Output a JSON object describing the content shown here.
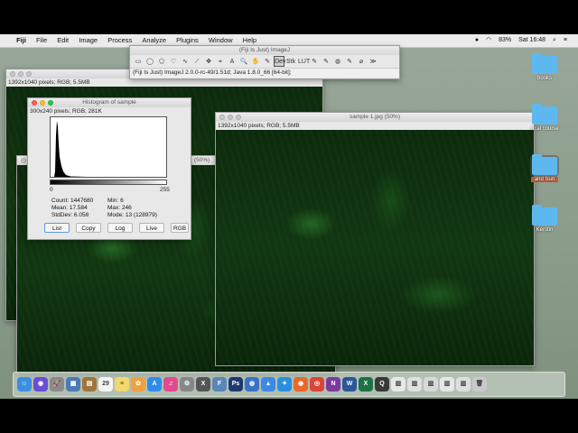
{
  "menubar": {
    "apple": "",
    "items": [
      "Fiji",
      "File",
      "Edit",
      "Image",
      "Process",
      "Analyze",
      "Plugins",
      "Window",
      "Help"
    ],
    "battery": "83%",
    "clock": "Sat 16:48"
  },
  "toolbar": {
    "title": "(Fiji Is Just) ImageJ",
    "status": "(Fiji Is Just) ImageJ 2.0.0-rc-49/1.51d; Java 1.8.0_66 [64-bit];",
    "tools": [
      "▭",
      "◯",
      "⬠",
      "♡",
      "∿",
      "⟋",
      "✥",
      "⌖",
      "A",
      "🔍",
      "✋",
      "✎",
      "Dev",
      "Stk",
      "LUT",
      "✎",
      "✎",
      "◍",
      "✎",
      "⌀",
      "≫"
    ]
  },
  "back_window": {
    "info": "1392x1040 pixels; RGB; 5.5MB"
  },
  "middle_window": {
    "title": "(50%)"
  },
  "histogram": {
    "title": "Histogram of sample",
    "info": "300x240 pixels; RGB; 281K",
    "axis_min": "0",
    "axis_max": "255",
    "count": "Count: 1447680",
    "mean": "Mean: 17.584",
    "stddev": "StdDev: 6.058",
    "min": "Min: 6",
    "max": "Max: 246",
    "mode": "Mode: 13 (128979)",
    "buttons": [
      "List",
      "Copy",
      "Log",
      "Live",
      "RGB"
    ]
  },
  "sample_window": {
    "title": "sample 1.jpg (50%)",
    "info": "1392x1040 pixels; RGB; 5.5MB"
  },
  "desktop_folders": [
    "books",
    "ocal course",
    "and Sun",
    "Kerstin"
  ],
  "dock_icons": [
    {
      "name": "finder-icon",
      "color": "#3b8fe0",
      "glyph": "☺"
    },
    {
      "name": "siri-icon",
      "color": "#6a4fd1",
      "glyph": "◉"
    },
    {
      "name": "launchpad-icon",
      "color": "#8a8a8a",
      "glyph": "🚀"
    },
    {
      "name": "preview-icon",
      "color": "#4a7ab8",
      "glyph": "▦"
    },
    {
      "name": "contacts-icon",
      "color": "#a0743c",
      "glyph": "▤"
    },
    {
      "name": "calendar-icon",
      "color": "#f4f4f4",
      "glyph": "29"
    },
    {
      "name": "notes-icon",
      "color": "#f4d76a",
      "glyph": "≡"
    },
    {
      "name": "photos-icon",
      "color": "#f0a040",
      "glyph": "✿"
    },
    {
      "name": "appstore-icon",
      "color": "#2f8de8",
      "glyph": "A"
    },
    {
      "name": "itunes-icon",
      "color": "#e24a8f",
      "glyph": "♫"
    },
    {
      "name": "gear-icon",
      "color": "#888888",
      "glyph": "⚙"
    },
    {
      "name": "xquartz-icon",
      "color": "#555555",
      "glyph": "X"
    },
    {
      "name": "fiji-icon",
      "color": "#5a86b8",
      "glyph": "F"
    },
    {
      "name": "photoshop-icon",
      "color": "#1d3a6e",
      "glyph": "Ps"
    },
    {
      "name": "globe-icon",
      "color": "#3a72c8",
      "glyph": "◍"
    },
    {
      "name": "keynote-icon",
      "color": "#3c88e8",
      "glyph": "▲"
    },
    {
      "name": "safari-icon",
      "color": "#2a8fe0",
      "glyph": "✦"
    },
    {
      "name": "firefox-icon",
      "color": "#e8692a",
      "glyph": "◉"
    },
    {
      "name": "chrome-icon",
      "color": "#d9453a",
      "glyph": "◎"
    },
    {
      "name": "onenote-icon",
      "color": "#7b3aa0",
      "glyph": "N"
    },
    {
      "name": "word-icon",
      "color": "#2b5797",
      "glyph": "W"
    },
    {
      "name": "excel-icon",
      "color": "#1e7145",
      "glyph": "X"
    },
    {
      "name": "quicktime-icon",
      "color": "#3a3a3a",
      "glyph": "Q"
    },
    {
      "name": "document-icon",
      "color": "#e8e8e8",
      "glyph": "▥"
    },
    {
      "name": "document-icon-2",
      "color": "#e0e0e0",
      "glyph": "▥"
    },
    {
      "name": "document-icon-3",
      "color": "#d8d8d8",
      "glyph": "▥"
    },
    {
      "name": "document-icon-4",
      "color": "#e6e6e6",
      "glyph": "▥"
    },
    {
      "name": "document-icon-5",
      "color": "#dedede",
      "glyph": "▥"
    },
    {
      "name": "trash-icon",
      "color": "#c9c9c9",
      "glyph": "🗑"
    }
  ],
  "colors": {
    "accent": "#5a9ae6",
    "microscopy": "#1c5a1c"
  }
}
